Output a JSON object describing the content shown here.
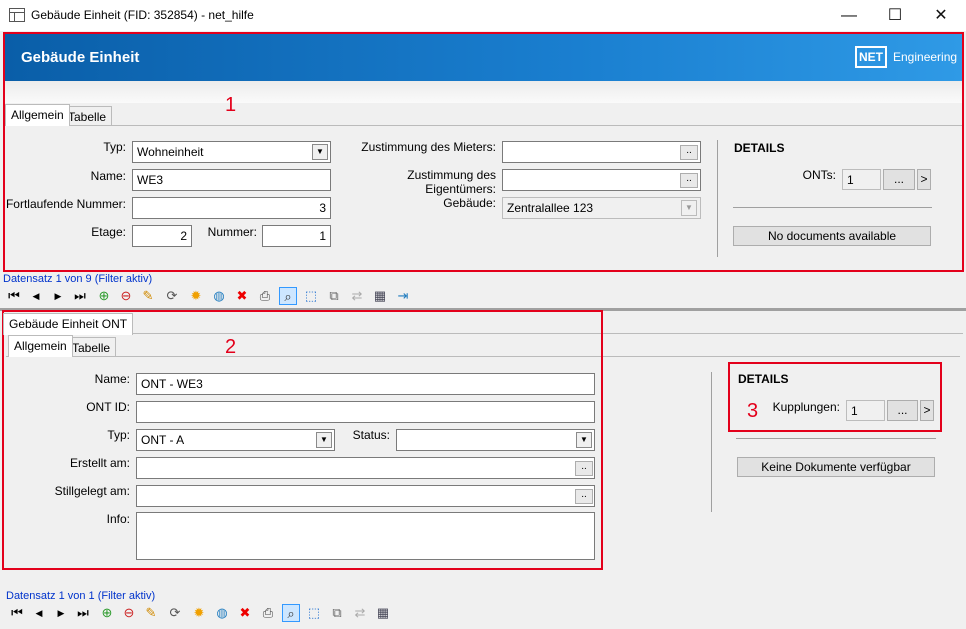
{
  "window": {
    "title": "Gebäude Einheit (FID: 352854) - net_hilfe",
    "minimize": "—",
    "maximize": "☐",
    "close": "✕"
  },
  "banner": {
    "title": "Gebäude Einheit",
    "logo_box": "NET",
    "logo_text": "Engineering",
    "accent": "#0a5ea8"
  },
  "top": {
    "tabs": [
      "Allgemein",
      "Tabelle"
    ],
    "typ_label": "Typ:",
    "typ_value": "Wohneinheit",
    "name_label": "Name:",
    "name_value": "WE3",
    "fortlaufende_label": "Fortlaufende Nummer:",
    "fortlaufende_value": "3",
    "etage_label": "Etage:",
    "etage_value": "2",
    "nummer_label": "Nummer:",
    "nummer_value": "1",
    "zust_mieter_label": "Zustimmung des Mieters:",
    "zust_mieter_value": "",
    "zust_eig_label": "Zustimmung des Eigentümers:",
    "zust_eig_value": "",
    "gebaeude_label": "Gebäude:",
    "gebaeude_value": "Zentralallee 123",
    "details_title": "DETAILS",
    "onts_label": "ONTs:",
    "onts_value": "1",
    "ellipsis": "...",
    "arrow": ">",
    "small_ellipsis": "..",
    "no_docs": "No documents available",
    "record": "Datensatz 1 von 9 (Filter aktiv)"
  },
  "bottom": {
    "outer_tab": "Gebäude Einheit ONT",
    "tabs": [
      "Allgemein",
      "Tabelle"
    ],
    "name_label": "Name:",
    "name_value": "ONT - WE3",
    "ontid_label": "ONT ID:",
    "ontid_value": "",
    "typ_label": "Typ:",
    "typ_value": "ONT - A",
    "status_label": "Status:",
    "status_value": "",
    "erstellt_label": "Erstellt am:",
    "erstellt_value": "",
    "stillgelegt_label": "Stillgelegt am:",
    "stillgelegt_value": "",
    "info_label": "Info:",
    "info_value": "",
    "details_title": "DETAILS",
    "kupplungen_label": "Kupplungen:",
    "kupplungen_value": "1",
    "ellipsis": "...",
    "arrow": ">",
    "small_ellipsis": "..",
    "no_docs": "Keine Dokumente verfügbar",
    "record": "Datensatz 1 von 1 (Filter aktiv)"
  },
  "annotations": {
    "box1": "1",
    "box2": "2",
    "box3": "3",
    "color": "#e3001b"
  },
  "toolbar_icons": {
    "first": "⏮",
    "prev": "◀",
    "next": "▶",
    "last": "⏭",
    "filter_add": "⊕",
    "filter_remove": "⊖",
    "edit": "✎",
    "refresh": "⟳",
    "new": "✹",
    "globe": "◍",
    "delete": "✖",
    "print": "⎙",
    "zoom": "⌕",
    "select": "⬚",
    "copy": "⧉",
    "move": "⇄",
    "table": "▦",
    "exit": "⇥"
  }
}
